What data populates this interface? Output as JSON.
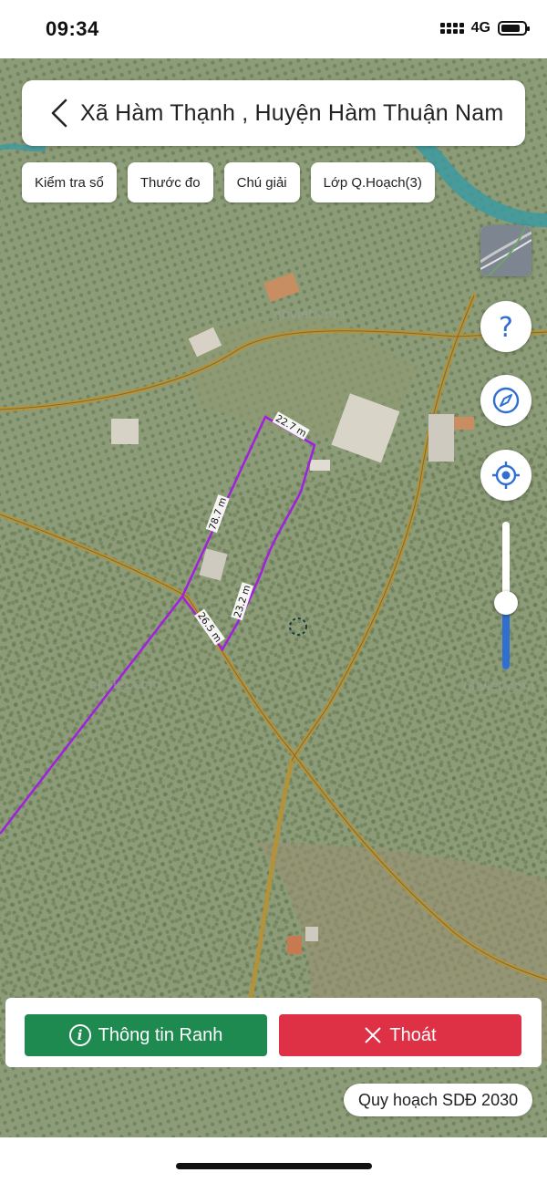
{
  "status_bar": {
    "time": "09:34",
    "network": "4G",
    "battery_level": 0.7
  },
  "header": {
    "title": "Xã Hàm Thạnh , Huyện Hàm Thuận Nam"
  },
  "toolbar": {
    "chips": [
      {
        "label": "Kiểm tra sổ"
      },
      {
        "label": "Thước đo"
      },
      {
        "label": "Chú giải"
      },
      {
        "label": "Lớp Q.Hoạch(3)"
      }
    ]
  },
  "map": {
    "measurements": [
      {
        "label": "22.7 m"
      },
      {
        "label": "78.7 m"
      },
      {
        "label": "23.2 m"
      },
      {
        "label": "26.5 m"
      }
    ],
    "watermarks": [
      "qhviet.com",
      "qhviet.com",
      "qhviet.com"
    ],
    "parcel_color": "#a020e0",
    "road_color": "#b89236"
  },
  "side_controls": {
    "help_icon": "question-icon",
    "compass_icon": "compass-icon",
    "locate_icon": "locate-icon",
    "zoom_level": 0.45
  },
  "actions": {
    "info_label": "Thông tin Ranh",
    "exit_label": "Thoát"
  },
  "plan_badge": "Quy hoạch SDĐ 2030",
  "colors": {
    "info": "#1e8a4f",
    "exit": "#de3145",
    "accent": "#2f6fd1"
  }
}
